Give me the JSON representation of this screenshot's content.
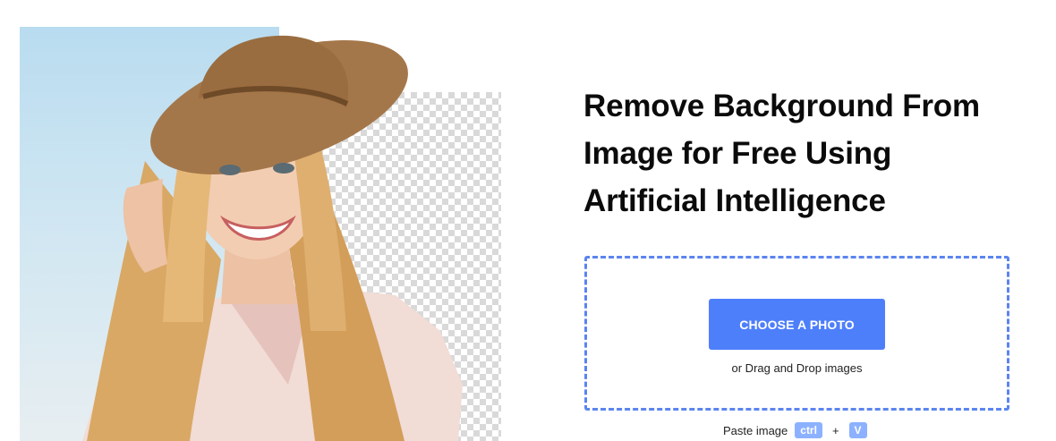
{
  "hero": {
    "image_description": "smiling woman in straw hat with partially removed background"
  },
  "headline": {
    "lines": [
      "Remove Background From",
      "Image for Free Using",
      "Artificial Intelligence"
    ]
  },
  "upload": {
    "button_label": "CHOOSE A PHOTO",
    "drag_text": "or Drag and Drop images"
  },
  "paste": {
    "label": "Paste image",
    "key1": "ctrl",
    "plus": "+",
    "key2": "V"
  },
  "colors": {
    "accent": "#4e7ffb",
    "dash_border": "#5b84f0",
    "key_bg": "#8cb1ff"
  }
}
